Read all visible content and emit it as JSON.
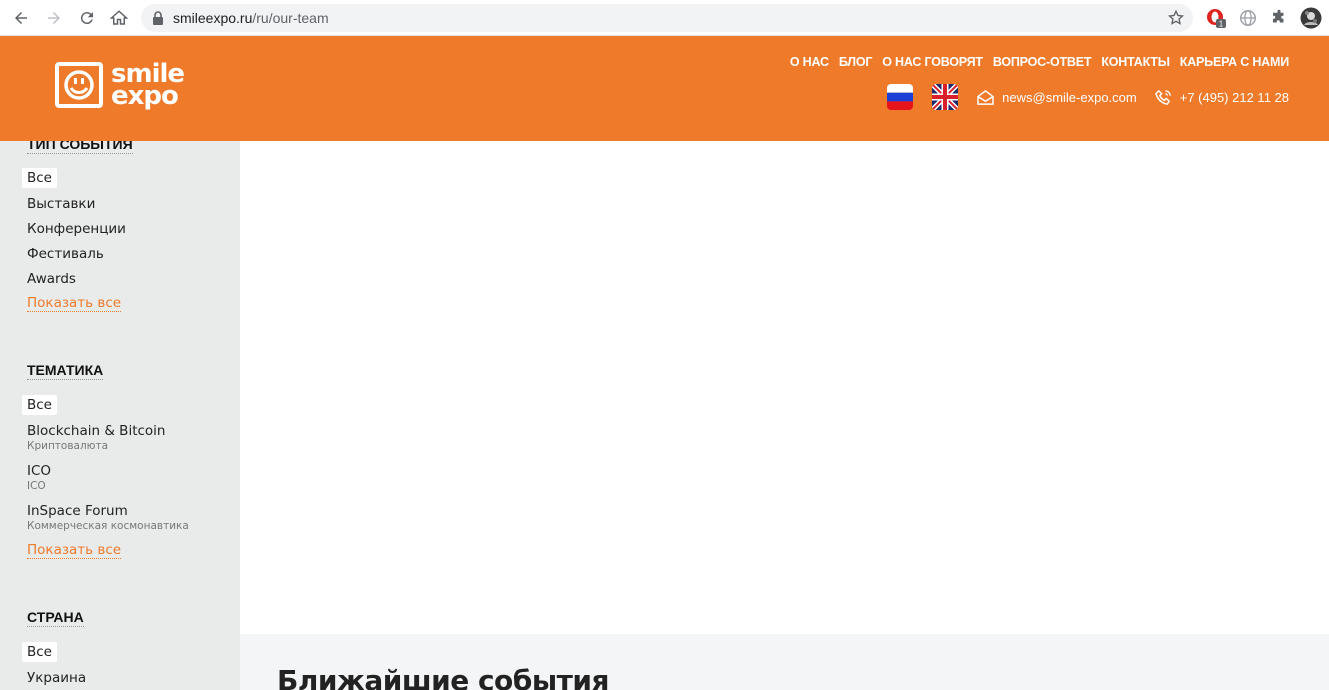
{
  "browser": {
    "url_domain": "smileexpo.ru",
    "url_path": "/ru/our-team",
    "ext_badge": "1"
  },
  "header": {
    "logo_line1": "smile",
    "logo_line2": "expo",
    "nav": [
      "О НАС",
      "БЛОГ",
      "О НАС ГОВОРЯТ",
      "ВОПРОС-ОТВЕТ",
      "КОНТАКТЫ",
      "КАРЬЕРА С НАМИ"
    ],
    "email": "news@smile-expo.com",
    "phone": "+7 (495) 212 11 28"
  },
  "sidebar": {
    "type_title": "ТИП СОБЫТИЯ",
    "type_items": [
      "Все",
      "Выставки",
      "Конференции",
      "Фестиваль",
      "Awards"
    ],
    "show_all": "Показать все",
    "theme_title": "ТЕМАТИКА",
    "theme_all": "Все",
    "theme_items": [
      {
        "label": "Blockchain & Bitcoin",
        "sub": "Криптовалюта"
      },
      {
        "label": "ICO",
        "sub": "ICO"
      },
      {
        "label": "InSpace Forum",
        "sub": "Коммерческая космонавтика"
      }
    ],
    "country_title": "СТРАНА",
    "country_items": [
      "Все",
      "Украина"
    ]
  },
  "events": {
    "title": "Ближайшие события"
  },
  "colors": {
    "brand_orange": "#ee7a2a",
    "sidebar_bg": "#e9ebeb"
  }
}
